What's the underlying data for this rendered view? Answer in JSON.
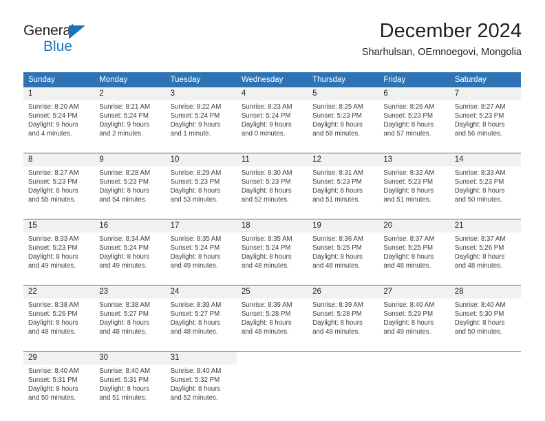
{
  "logo": {
    "word_one": "General",
    "word_two": "Blue",
    "triangle_color": "#1b75bb"
  },
  "header": {
    "title": "December 2024",
    "subtitle": "Sharhulsan, OEmnoegovi, Mongolia"
  },
  "theme": {
    "header_blue": "#2e74b5",
    "daynum_band": "#f1f1f1",
    "text": "#231f20"
  },
  "calendar": {
    "weekday_headers": [
      "Sunday",
      "Monday",
      "Tuesday",
      "Wednesday",
      "Thursday",
      "Friday",
      "Saturday"
    ],
    "weeks": [
      [
        {
          "day": "1",
          "sunrise": "Sunrise: 8:20 AM",
          "sunset": "Sunset: 5:24 PM",
          "daylight_1": "Daylight: 9 hours",
          "daylight_2": "and 4 minutes."
        },
        {
          "day": "2",
          "sunrise": "Sunrise: 8:21 AM",
          "sunset": "Sunset: 5:24 PM",
          "daylight_1": "Daylight: 9 hours",
          "daylight_2": "and 2 minutes."
        },
        {
          "day": "3",
          "sunrise": "Sunrise: 8:22 AM",
          "sunset": "Sunset: 5:24 PM",
          "daylight_1": "Daylight: 9 hours",
          "daylight_2": "and 1 minute."
        },
        {
          "day": "4",
          "sunrise": "Sunrise: 8:23 AM",
          "sunset": "Sunset: 5:24 PM",
          "daylight_1": "Daylight: 9 hours",
          "daylight_2": "and 0 minutes."
        },
        {
          "day": "5",
          "sunrise": "Sunrise: 8:25 AM",
          "sunset": "Sunset: 5:23 PM",
          "daylight_1": "Daylight: 8 hours",
          "daylight_2": "and 58 minutes."
        },
        {
          "day": "6",
          "sunrise": "Sunrise: 8:26 AM",
          "sunset": "Sunset: 5:23 PM",
          "daylight_1": "Daylight: 8 hours",
          "daylight_2": "and 57 minutes."
        },
        {
          "day": "7",
          "sunrise": "Sunrise: 8:27 AM",
          "sunset": "Sunset: 5:23 PM",
          "daylight_1": "Daylight: 8 hours",
          "daylight_2": "and 56 minutes."
        }
      ],
      [
        {
          "day": "8",
          "sunrise": "Sunrise: 8:27 AM",
          "sunset": "Sunset: 5:23 PM",
          "daylight_1": "Daylight: 8 hours",
          "daylight_2": "and 55 minutes."
        },
        {
          "day": "9",
          "sunrise": "Sunrise: 8:28 AM",
          "sunset": "Sunset: 5:23 PM",
          "daylight_1": "Daylight: 8 hours",
          "daylight_2": "and 54 minutes."
        },
        {
          "day": "10",
          "sunrise": "Sunrise: 8:29 AM",
          "sunset": "Sunset: 5:23 PM",
          "daylight_1": "Daylight: 8 hours",
          "daylight_2": "and 53 minutes."
        },
        {
          "day": "11",
          "sunrise": "Sunrise: 8:30 AM",
          "sunset": "Sunset: 5:23 PM",
          "daylight_1": "Daylight: 8 hours",
          "daylight_2": "and 52 minutes."
        },
        {
          "day": "12",
          "sunrise": "Sunrise: 8:31 AM",
          "sunset": "Sunset: 5:23 PM",
          "daylight_1": "Daylight: 8 hours",
          "daylight_2": "and 51 minutes."
        },
        {
          "day": "13",
          "sunrise": "Sunrise: 8:32 AM",
          "sunset": "Sunset: 5:23 PM",
          "daylight_1": "Daylight: 8 hours",
          "daylight_2": "and 51 minutes."
        },
        {
          "day": "14",
          "sunrise": "Sunrise: 8:33 AM",
          "sunset": "Sunset: 5:23 PM",
          "daylight_1": "Daylight: 8 hours",
          "daylight_2": "and 50 minutes."
        }
      ],
      [
        {
          "day": "15",
          "sunrise": "Sunrise: 8:33 AM",
          "sunset": "Sunset: 5:23 PM",
          "daylight_1": "Daylight: 8 hours",
          "daylight_2": "and 49 minutes."
        },
        {
          "day": "16",
          "sunrise": "Sunrise: 8:34 AM",
          "sunset": "Sunset: 5:24 PM",
          "daylight_1": "Daylight: 8 hours",
          "daylight_2": "and 49 minutes."
        },
        {
          "day": "17",
          "sunrise": "Sunrise: 8:35 AM",
          "sunset": "Sunset: 5:24 PM",
          "daylight_1": "Daylight: 8 hours",
          "daylight_2": "and 49 minutes."
        },
        {
          "day": "18",
          "sunrise": "Sunrise: 8:35 AM",
          "sunset": "Sunset: 5:24 PM",
          "daylight_1": "Daylight: 8 hours",
          "daylight_2": "and 48 minutes."
        },
        {
          "day": "19",
          "sunrise": "Sunrise: 8:36 AM",
          "sunset": "Sunset: 5:25 PM",
          "daylight_1": "Daylight: 8 hours",
          "daylight_2": "and 48 minutes."
        },
        {
          "day": "20",
          "sunrise": "Sunrise: 8:37 AM",
          "sunset": "Sunset: 5:25 PM",
          "daylight_1": "Daylight: 8 hours",
          "daylight_2": "and 48 minutes."
        },
        {
          "day": "21",
          "sunrise": "Sunrise: 8:37 AM",
          "sunset": "Sunset: 5:26 PM",
          "daylight_1": "Daylight: 8 hours",
          "daylight_2": "and 48 minutes."
        }
      ],
      [
        {
          "day": "22",
          "sunrise": "Sunrise: 8:38 AM",
          "sunset": "Sunset: 5:26 PM",
          "daylight_1": "Daylight: 8 hours",
          "daylight_2": "and 48 minutes."
        },
        {
          "day": "23",
          "sunrise": "Sunrise: 8:38 AM",
          "sunset": "Sunset: 5:27 PM",
          "daylight_1": "Daylight: 8 hours",
          "daylight_2": "and 48 minutes."
        },
        {
          "day": "24",
          "sunrise": "Sunrise: 8:39 AM",
          "sunset": "Sunset: 5:27 PM",
          "daylight_1": "Daylight: 8 hours",
          "daylight_2": "and 48 minutes."
        },
        {
          "day": "25",
          "sunrise": "Sunrise: 8:39 AM",
          "sunset": "Sunset: 5:28 PM",
          "daylight_1": "Daylight: 8 hours",
          "daylight_2": "and 48 minutes."
        },
        {
          "day": "26",
          "sunrise": "Sunrise: 8:39 AM",
          "sunset": "Sunset: 5:28 PM",
          "daylight_1": "Daylight: 8 hours",
          "daylight_2": "and 49 minutes."
        },
        {
          "day": "27",
          "sunrise": "Sunrise: 8:40 AM",
          "sunset": "Sunset: 5:29 PM",
          "daylight_1": "Daylight: 8 hours",
          "daylight_2": "and 49 minutes."
        },
        {
          "day": "28",
          "sunrise": "Sunrise: 8:40 AM",
          "sunset": "Sunset: 5:30 PM",
          "daylight_1": "Daylight: 8 hours",
          "daylight_2": "and 50 minutes."
        }
      ],
      [
        {
          "day": "29",
          "sunrise": "Sunrise: 8:40 AM",
          "sunset": "Sunset: 5:31 PM",
          "daylight_1": "Daylight: 8 hours",
          "daylight_2": "and 50 minutes."
        },
        {
          "day": "30",
          "sunrise": "Sunrise: 8:40 AM",
          "sunset": "Sunset: 5:31 PM",
          "daylight_1": "Daylight: 8 hours",
          "daylight_2": "and 51 minutes."
        },
        {
          "day": "31",
          "sunrise": "Sunrise: 8:40 AM",
          "sunset": "Sunset: 5:32 PM",
          "daylight_1": "Daylight: 8 hours",
          "daylight_2": "and 52 minutes."
        },
        {
          "day": "",
          "sunrise": "",
          "sunset": "",
          "daylight_1": "",
          "daylight_2": ""
        },
        {
          "day": "",
          "sunrise": "",
          "sunset": "",
          "daylight_1": "",
          "daylight_2": ""
        },
        {
          "day": "",
          "sunrise": "",
          "sunset": "",
          "daylight_1": "",
          "daylight_2": ""
        },
        {
          "day": "",
          "sunrise": "",
          "sunset": "",
          "daylight_1": "",
          "daylight_2": ""
        }
      ]
    ]
  }
}
